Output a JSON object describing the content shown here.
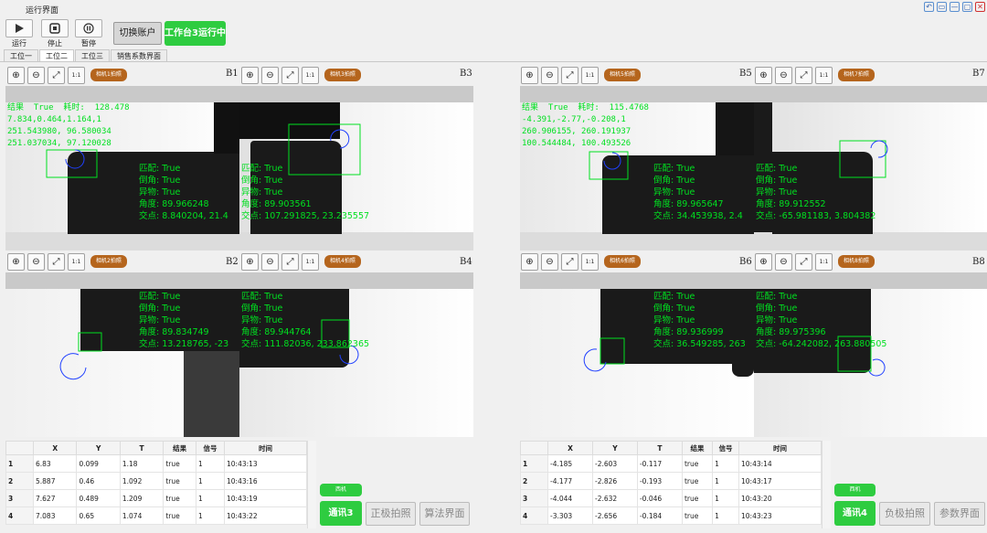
{
  "window": {
    "title": "运行界面",
    "controls": [
      "↶",
      "▭",
      "—",
      "▢",
      "✕"
    ]
  },
  "toolbar": {
    "run_label": "运行",
    "stop_label": "停止",
    "pause_label": "暂停",
    "switch_account": "切换账户",
    "status": "工作台3运行中"
  },
  "tabs": [
    "工位一",
    "工位二",
    "工位三",
    "销售系数界面"
  ],
  "zoom_icons": [
    "⊕",
    "⊖",
    "⤢",
    "1:1"
  ],
  "cameras": {
    "b1": {
      "id": "B1",
      "pill": "相机1拍照"
    },
    "b3": {
      "id": "B3",
      "pill": "相机3拍照"
    },
    "b2": {
      "id": "B2",
      "pill": "相机2拍照"
    },
    "b4": {
      "id": "B4",
      "pill": "相机4拍照"
    },
    "b5": {
      "id": "B5",
      "pill": "相机5拍照"
    },
    "b7": {
      "id": "B7",
      "pill": "相机7拍照"
    },
    "b6": {
      "id": "B6",
      "pill": "相机6拍照"
    },
    "b8": {
      "id": "B8",
      "pill": "相机8拍照"
    }
  },
  "overlays": {
    "left_top_header": "结果  True  耗时:  128.478\n7.834,0.464,1.164,1\n251.543980, 96.580034\n251.037034, 97.120028",
    "b1": "匹配: True\n倒角: True\n异物: True\n角度: 89.966248\n交点: 8.840204, 21.4",
    "b3": "匹配: True\n倒角: True\n异物: True\n角度: 89.903561\n交点: 107.291825, 23.235557",
    "b2": "匹配: True\n倒角: True\n异物: True\n角度: 89.834749\n交点: 13.218765, -23",
    "b4": "匹配: True\n倒角: True\n异物: True\n角度: 89.944764\n交点: 111.82036, 233.862365",
    "right_top_header": "结果  True  耗时:  115.4768\n-4.391,-2.77,-0.208,1\n260.906155, 260.191937\n100.544484, 100.493526",
    "b5": "匹配: True\n倒角: True\n异物: True\n角度: 89.965647\n交点: 34.453938, 2.4",
    "b7": "匹配: True\n倒角: True\n异物: True\n角度: 89.912552\n交点: -65.981183, 3.804382",
    "b6": "匹配: True\n倒角: True\n异物: True\n角度: 89.936999\n交点: 36.549285, 263",
    "b8": "匹配: True\n倒角: True\n异物: True\n角度: 89.975396\n交点: -64.242082, 263.880505"
  },
  "table_headers": [
    "",
    "X",
    "Y",
    "T",
    "结果",
    "信号",
    "时间"
  ],
  "left_table": [
    [
      "1",
      "6.83",
      "0.099",
      "1.18",
      "true",
      "1",
      "10:43:13"
    ],
    [
      "2",
      "5.887",
      "0.46",
      "1.092",
      "true",
      "1",
      "10:43:16"
    ],
    [
      "3",
      "7.627",
      "0.489",
      "1.209",
      "true",
      "1",
      "10:43:19"
    ],
    [
      "4",
      "7.083",
      "0.65",
      "1.074",
      "true",
      "1",
      "10:43:22"
    ]
  ],
  "right_table": [
    [
      "1",
      "-4.185",
      "-2.603",
      "-0.117",
      "true",
      "1",
      "10:43:14"
    ],
    [
      "2",
      "-4.177",
      "-2.826",
      "-0.193",
      "true",
      "1",
      "10:43:17"
    ],
    [
      "3",
      "-4.044",
      "-2.632",
      "-0.046",
      "true",
      "1",
      "10:43:20"
    ],
    [
      "4",
      "-3.303",
      "-2.656",
      "-0.184",
      "true",
      "1",
      "10:43:23"
    ]
  ],
  "left_actions": {
    "small": "西机",
    "comm": "通讯3",
    "pole": "正极拍照",
    "algo": "算法界面"
  },
  "right_actions": {
    "small": "西机",
    "comm": "通讯4",
    "pole": "负极拍照",
    "params": "参数界面"
  },
  "colors": {
    "green": "#2ecc40",
    "overlay": "#00e020",
    "pill": "#b5651d"
  }
}
